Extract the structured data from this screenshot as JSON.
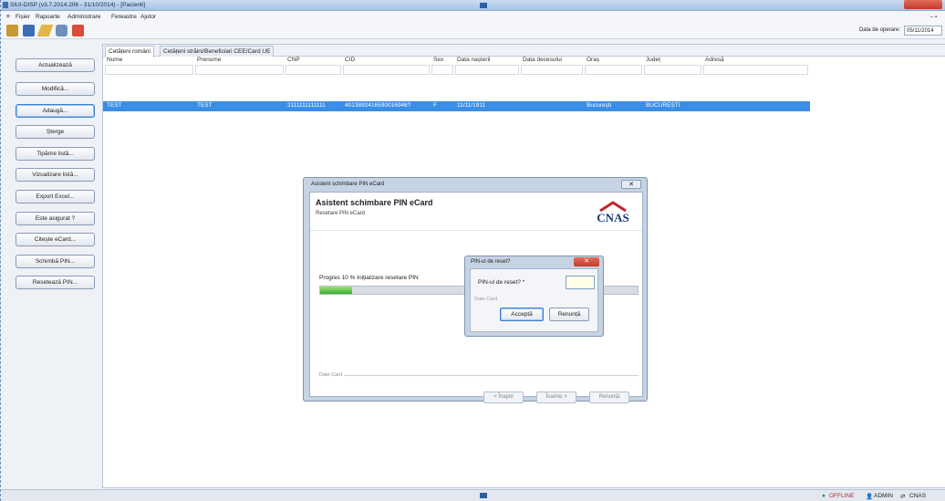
{
  "window": {
    "title": "SIUI-DISP (v3.7.2014.206 - 31/10/2014) - [Pacienti]"
  },
  "menu": [
    "Fișier",
    "Rapoarte",
    "Administrare",
    "Fereastre",
    "Ajutor"
  ],
  "toolbar": {
    "date_label": "Data de operare:",
    "date_value": "05/11/2014"
  },
  "sidebar": [
    "Actualizează",
    "Modifică...",
    "Adaugă...",
    "Șterge",
    "Tipărire listă...",
    "Vizualizare listă...",
    "Export Excel...",
    "Este asigurat ?",
    "Citește eCard...",
    "Schimbă PIN...",
    "Resetează PIN..."
  ],
  "tabs": [
    "Cetățeni români",
    "Cetățeni străini/Beneficiari CEE/Card UE"
  ],
  "grid": {
    "headers": [
      "Nume",
      "Prenume",
      "CNP",
      "CID",
      "Sex",
      "Data nașterii",
      "Data decesului",
      "Oraș",
      "Județ",
      "Adresă"
    ],
    "row": [
      "TEST",
      "TEST",
      "2111111111111",
      "4013892416590016946?",
      "F",
      "11/11/1911",
      "",
      "București",
      "BUCUREȘTI",
      ""
    ]
  },
  "wizard": {
    "title": "Asistent schimbare PIN eCard",
    "heading": "Asistent schimbare PIN eCard",
    "subheading": "Resetare PIN eCard",
    "logo_text": "CNAS",
    "progress_label": "Progres 10 % Inițializare resetare PIN",
    "progress": 10,
    "group_label": "Date Card",
    "back": "< Înapoi",
    "next": "Înainte >",
    "cancel": "Renunță"
  },
  "pin_dialog": {
    "title": "PIN-ul de reset?",
    "label": "PIN-ul de reset? *",
    "group_label": "Date Card",
    "ok": "Acceptă",
    "cancel": "Renunță"
  },
  "status": {
    "offline": "OFFLINE",
    "user": "ADMIN",
    "org": "CNAS"
  },
  "colors": {
    "selection": "#3a8ee6",
    "progress": "#3cae2e"
  }
}
